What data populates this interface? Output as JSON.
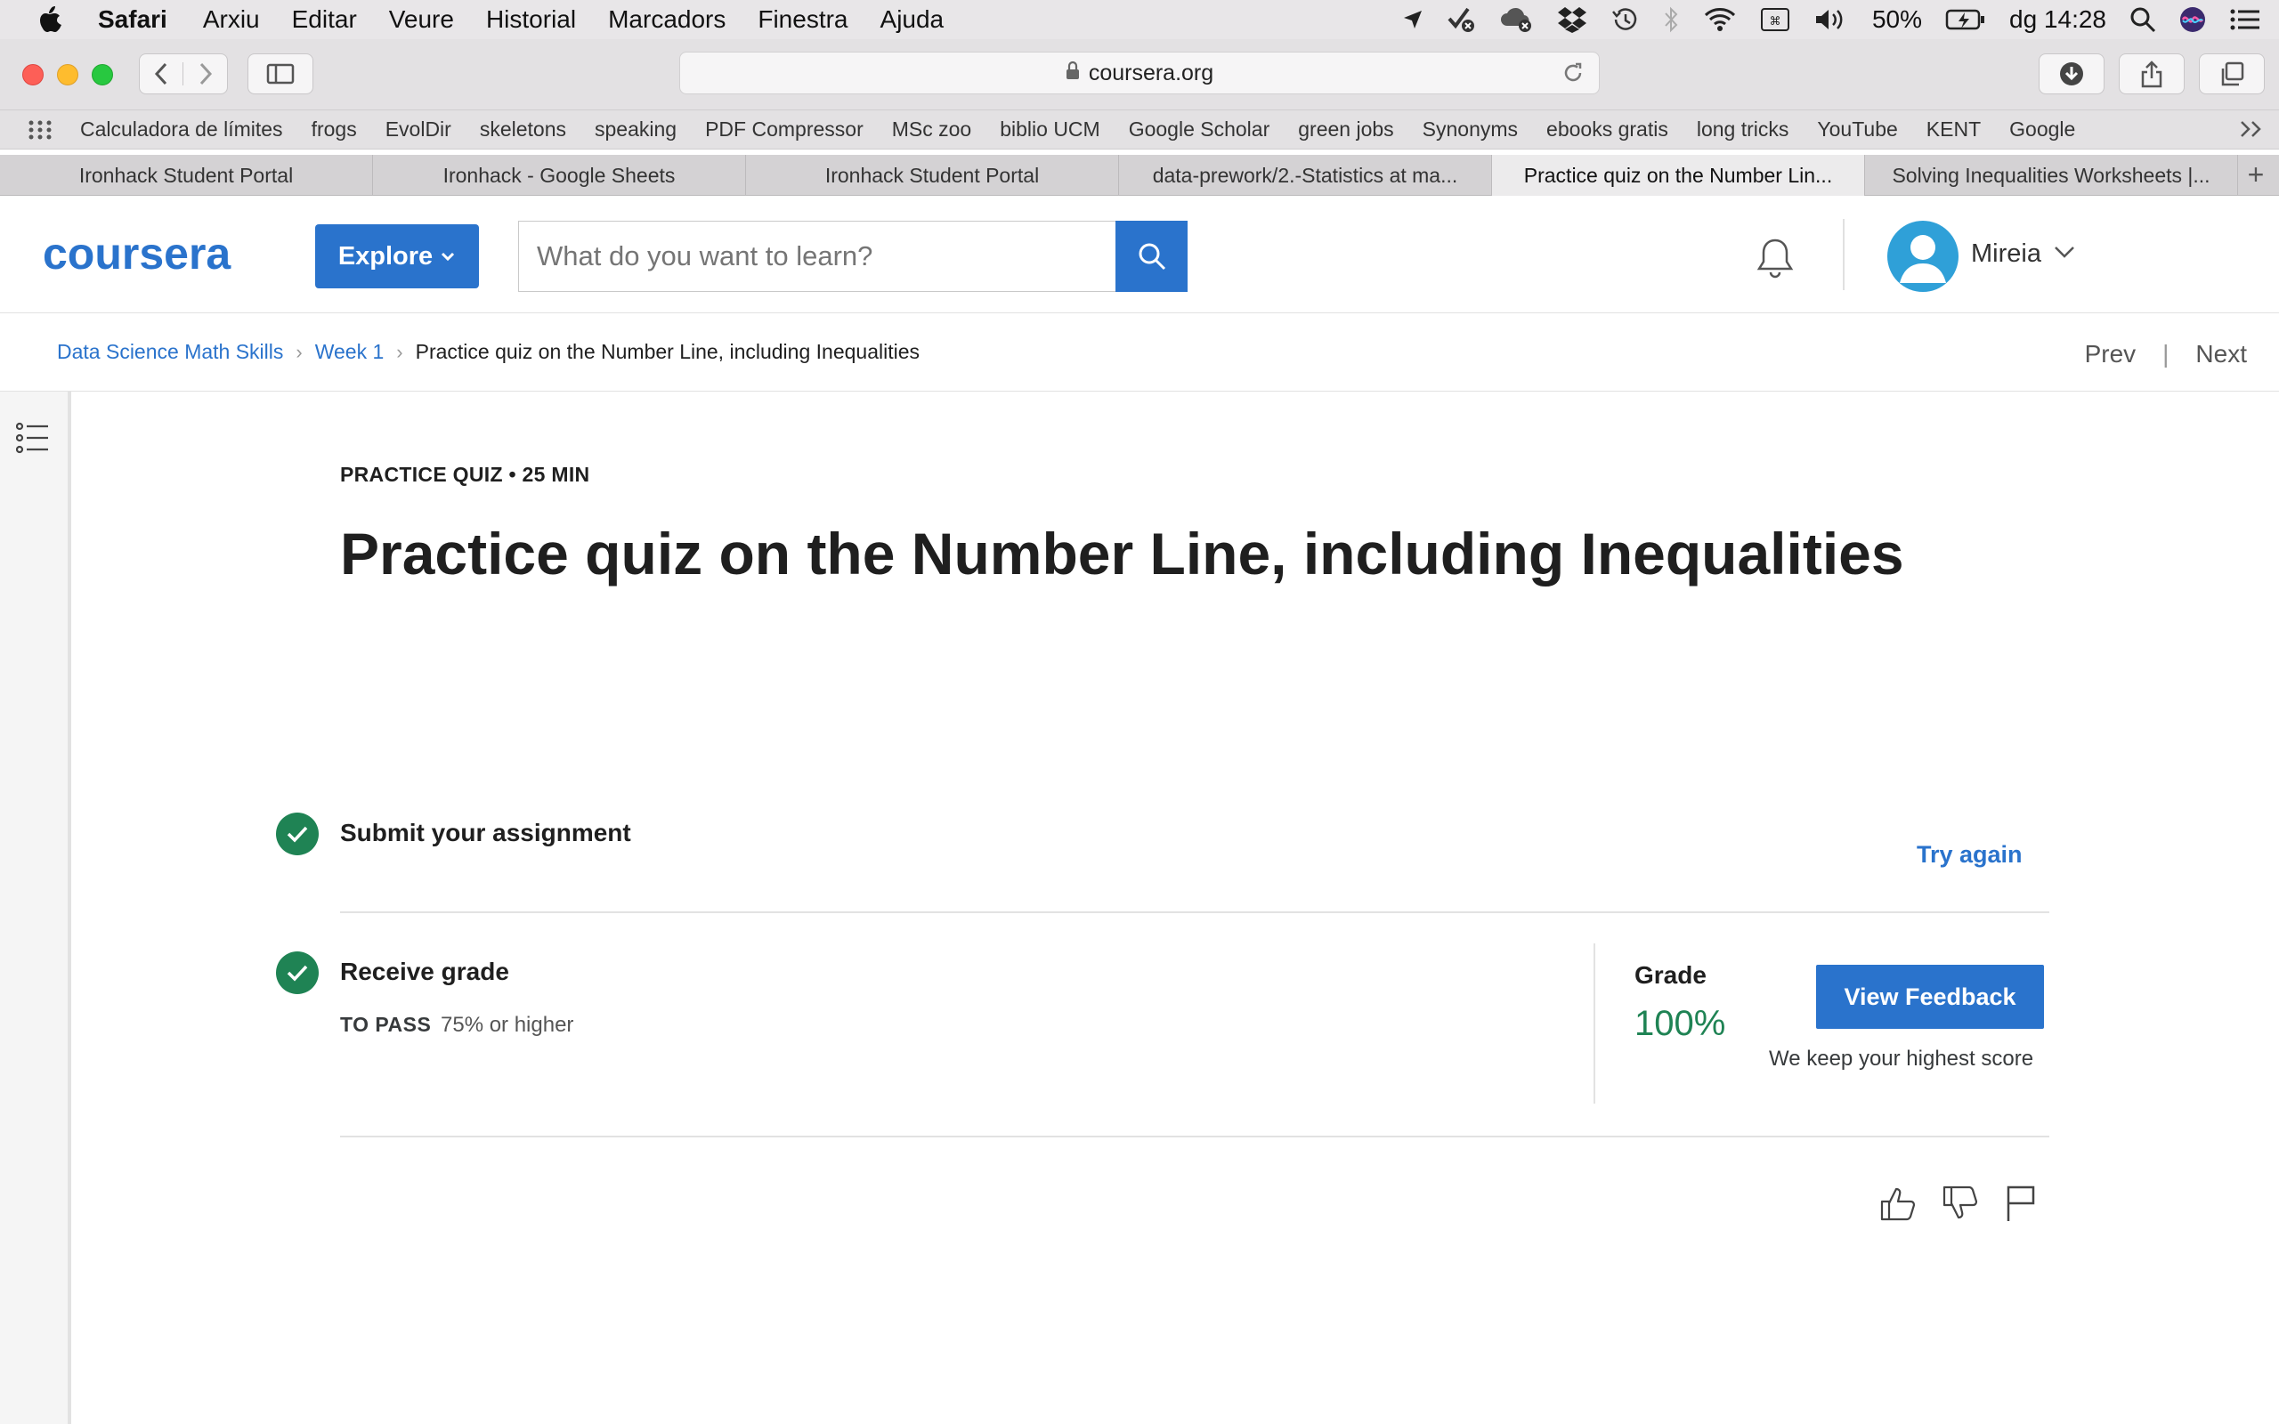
{
  "menubar": {
    "app": "Safari",
    "items": [
      "Arxiu",
      "Editar",
      "Veure",
      "Historial",
      "Marcadors",
      "Finestra",
      "Ajuda"
    ],
    "battery": "50%",
    "clock": "dg 14:28"
  },
  "toolbar": {
    "url": "coursera.org"
  },
  "bookmarks": [
    "Calculadora de límites",
    "frogs",
    "EvolDir",
    "skeletons",
    "speaking",
    "PDF Compressor",
    "MSc zoo",
    "biblio UCM",
    "Google Scholar",
    "green jobs",
    "Synonyms",
    "ebooks gratis",
    "long tricks",
    "YouTube",
    "KENT",
    "Google"
  ],
  "tabs": [
    {
      "label": "Ironhack Student Portal"
    },
    {
      "label": "Ironhack - Google Sheets"
    },
    {
      "label": "Ironhack Student Portal"
    },
    {
      "label": "data-prework/2.-Statistics at ma..."
    },
    {
      "label": "Practice quiz on the Number Lin..."
    },
    {
      "label": "Solving Inequalities Worksheets |..."
    }
  ],
  "header": {
    "logo": "coursera",
    "explore_label": "Explore",
    "search_placeholder": "What do you want to learn?",
    "user_name": "Mireia"
  },
  "breadcrumb": {
    "course": "Data Science Math Skills",
    "week": "Week 1",
    "current": "Practice quiz on the Number Line, including Inequalities",
    "prev": "Prev",
    "next": "Next"
  },
  "content": {
    "eyebrow": "PRACTICE QUIZ • 25 MIN",
    "title": "Practice quiz on the Number Line, including Inequalities",
    "step1_label": "Submit your assignment",
    "try_again": "Try again",
    "step2_label": "Receive grade",
    "to_pass_label": "TO PASS",
    "to_pass_value": "75% or higher",
    "grade_label": "Grade",
    "grade_value": "100%",
    "feedback_button": "View Feedback",
    "highest_note": "We keep your highest score"
  },
  "colors": {
    "coursera_blue": "#2a73cc",
    "success_green": "#1f8354"
  }
}
